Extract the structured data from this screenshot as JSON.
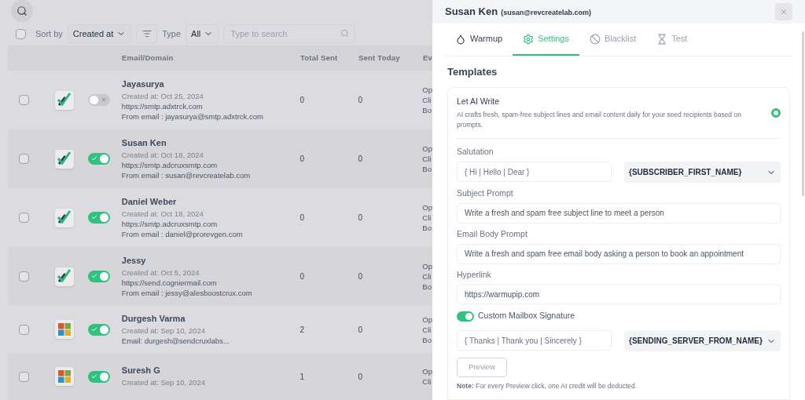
{
  "toolbar": {
    "select_all_checked": false,
    "sort_label": "Sort by",
    "sort_value": "Created at",
    "type_label": "Type",
    "type_value": "All",
    "search": {
      "placeholder": "Type to search"
    }
  },
  "table": {
    "columns": [
      "Email/Domain",
      "Total Sent",
      "Sent Today",
      "Ev"
    ],
    "rows": [
      {
        "kind": "check",
        "checked": false,
        "on": false,
        "name": "Jayasurya",
        "created": "Created at: Oct 25, 2024",
        "lines": [
          "https://smtp.adxtrck.com",
          "From email : jayasurya@smtp.adxtrck.com"
        ],
        "total": "0",
        "today": "0",
        "events": [
          "Op",
          "Cli",
          "Bo"
        ]
      },
      {
        "kind": "check",
        "checked": false,
        "on": true,
        "name": "Susan Ken",
        "created": "Created at: Oct 18, 2024",
        "lines": [
          "https://smtp.adcruxsmtp.com",
          "From email : susan@revcreatelab.com"
        ],
        "total": "0",
        "today": "0",
        "events": [
          "Op",
          "Cli",
          "Bo"
        ]
      },
      {
        "kind": "check",
        "checked": false,
        "on": true,
        "name": "Daniel Weber",
        "created": "Created at: Oct 18, 2024",
        "lines": [
          "https://smtp.adcruxsmtp.com",
          "From email : daniel@prorevgen.com"
        ],
        "total": "0",
        "today": "0",
        "events": [
          "Op",
          "Cli",
          "Bo"
        ]
      },
      {
        "kind": "check",
        "checked": false,
        "on": true,
        "name": "Jessy",
        "created": "Created at: Oct 5, 2024",
        "lines": [
          "https://send.cogniermail.com",
          "From email : jessy@alesboostcrux.com"
        ],
        "total": "0",
        "today": "0",
        "events": [
          "Op",
          "Cli",
          "Bo"
        ]
      },
      {
        "kind": "windows",
        "checked": false,
        "on": true,
        "name": "Durgesh Varma",
        "created": "Created at: Sep 10, 2024",
        "lines": [
          "Email: durgesh@sendcruxlabs..."
        ],
        "total": "2",
        "today": "0",
        "events": [
          "Op",
          "Cli",
          "Bo"
        ]
      },
      {
        "kind": "windows",
        "checked": false,
        "on": true,
        "name": "Suresh G",
        "created": "Created at: Sep 10, 2024",
        "lines": [],
        "total": "1",
        "today": "0",
        "events": [
          "Op",
          "Cli"
        ]
      }
    ]
  },
  "panel": {
    "name": "Susan Ken",
    "email": "(susan@revcreatelab.com)",
    "tabs": [
      {
        "label": "Warmup",
        "selected": false
      },
      {
        "label": "Settings",
        "selected": true
      },
      {
        "label": "Blacklist",
        "selected": false
      },
      {
        "label": "Test",
        "selected": false
      }
    ],
    "section_title": "Templates",
    "ai": {
      "title": "Let AI Write",
      "description": "AI crafts fresh, spam-free subject lines and email content daily for your seed recipients based on prompts.",
      "selected": true
    },
    "salutation": {
      "label": "Salutation",
      "placeholder": "{ Hi | Hello | Dear }",
      "select": "{SUBSCRIBER_FIRST_NAME}"
    },
    "subject": {
      "label": "Subject Prompt",
      "value": "Write a fresh and spam free subject line to meet a person"
    },
    "body": {
      "label": "Email Body Prompt",
      "value": "Write a fresh and spam free email body asking a person to book an appointment"
    },
    "hyperlink": {
      "label": "Hyperlink",
      "value": "https://warmupip.com"
    },
    "signature": {
      "label": "Custom Mailbox Signature",
      "on": true,
      "placeholder": "{ Thanks | Thank you | Sincerely }",
      "select": "{SENDING_SERVER_FROM_NAME}"
    },
    "preview_button": "Preview",
    "note": "**Note:** For every Preview click, one AI credit will be deducted."
  }
}
